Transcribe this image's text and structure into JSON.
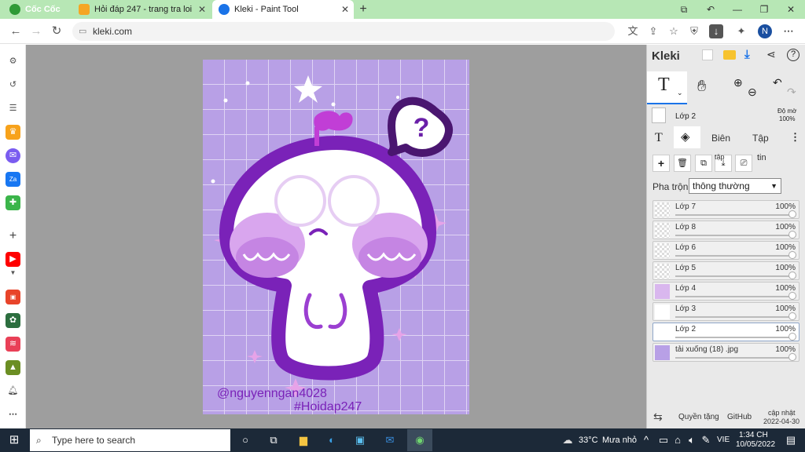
{
  "browser": {
    "brand": "Cốc Cốc",
    "tabs": [
      {
        "title": "Hỏi đáp 247 - trang tra loi",
        "active": false
      },
      {
        "title": "Kleki - Paint Tool",
        "active": true
      }
    ],
    "new_tab_label": "+",
    "url": "kleki.com",
    "profile_initial": "N"
  },
  "colors": {
    "tab_strip": "#b7e7b5",
    "canvas_bg": "#9e9e9e",
    "art_purple": "#b8a0e6",
    "outline_purple": "#7a22b8",
    "taskbar": "#1c2938",
    "accent_blue": "#1a73e8"
  },
  "kleki": {
    "logo": "Kleki",
    "current_layer": "Lớp 2",
    "opacity_label": "Độ mờ",
    "opacity_value": "100%",
    "tabs": {
      "edit": "Biên",
      "file": "Tập",
      "tap_suffix": "tập",
      "tin_suffix": "tin"
    },
    "blend_label": "Pha trộn",
    "blend_value": "thông thường",
    "layers": [
      {
        "name": "Lớp 7",
        "opacity": "100%",
        "selected": false
      },
      {
        "name": "Lớp 8",
        "opacity": "100%",
        "selected": false
      },
      {
        "name": "Lớp 6",
        "opacity": "100%",
        "selected": false
      },
      {
        "name": "Lớp 5",
        "opacity": "100%",
        "selected": false
      },
      {
        "name": "Lớp 4",
        "opacity": "100%",
        "selected": false
      },
      {
        "name": "Lớp 3",
        "opacity": "100%",
        "selected": false
      },
      {
        "name": "Lớp 2",
        "opacity": "100%",
        "selected": true
      },
      {
        "name": "tải xuống (18) .jpg",
        "opacity": "100%",
        "selected": false
      }
    ],
    "footer": {
      "privacy": "Quyền tặng",
      "github": "GitHub",
      "update_label": "cập nhật",
      "update_date": "2022-04-30"
    }
  },
  "artwork": {
    "watermark_user": "@nguyenngan4028",
    "watermark_tag": "#Hoidap247",
    "speech_symbol": "?"
  },
  "taskbar": {
    "search_placeholder": "Type here to search",
    "weather_temp": "33°C",
    "weather_desc": "Mưa nhỏ",
    "language": "VIE",
    "time": "1:34 CH",
    "date": "10/05/2022"
  }
}
